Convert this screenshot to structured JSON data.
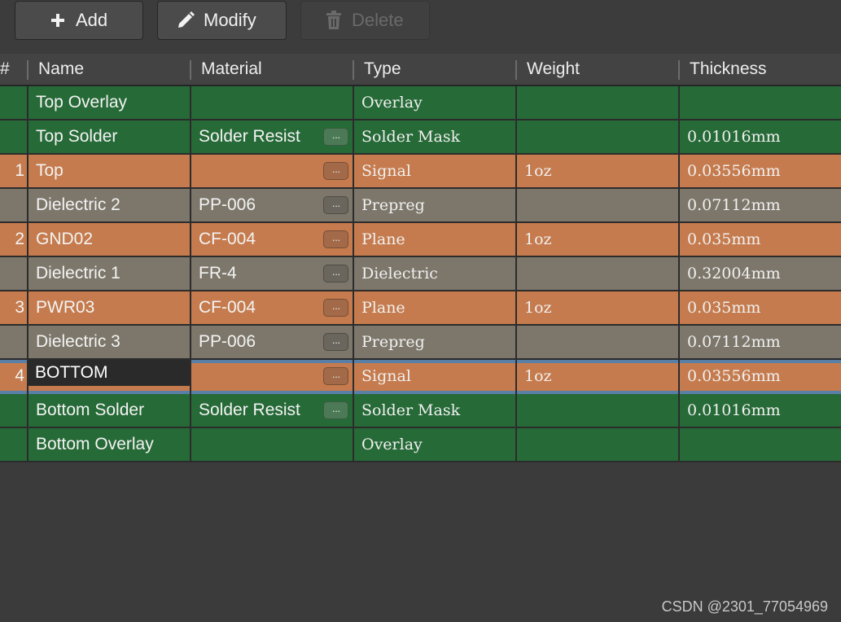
{
  "toolbar": {
    "add": {
      "label": "Add",
      "icon": "plus-icon"
    },
    "modify": {
      "label": "Modify",
      "icon": "pencil-icon"
    },
    "delete": {
      "label": "Delete",
      "icon": "trash-icon",
      "disabled": true
    }
  },
  "columns": [
    "#",
    "Name",
    "Material",
    "Type",
    "Weight",
    "Thickness"
  ],
  "colors": {
    "dielectric": "#7d776b",
    "signal": "#c57b4d",
    "mask": "#266a37",
    "selection": "#5a7fa7"
  },
  "rows": [
    {
      "num": "",
      "name": "Top Overlay",
      "material": "",
      "type": "Overlay",
      "weight": "",
      "thickness": "",
      "color": "green",
      "has_dots": false
    },
    {
      "num": "",
      "name": "Top Solder",
      "material": "Solder Resist",
      "type": "Solder Mask",
      "weight": "",
      "thickness": "0.01016mm",
      "color": "green",
      "has_dots": true
    },
    {
      "num": "1",
      "name": "Top",
      "material": "",
      "type": "Signal",
      "weight": "1oz",
      "thickness": "0.03556mm",
      "color": "orange",
      "has_dots": true
    },
    {
      "num": "",
      "name": "Dielectric 2",
      "material": "PP-006",
      "type": "Prepreg",
      "weight": "",
      "thickness": "0.07112mm",
      "color": "gray",
      "has_dots": true
    },
    {
      "num": "2",
      "name": "GND02",
      "material": "CF-004",
      "type": "Plane",
      "weight": "1oz",
      "thickness": "0.035mm",
      "color": "orange",
      "has_dots": true
    },
    {
      "num": "",
      "name": "Dielectric 1",
      "material": "FR-4",
      "type": "Dielectric",
      "weight": "",
      "thickness": "0.32004mm",
      "color": "gray",
      "has_dots": true
    },
    {
      "num": "3",
      "name": "PWR03",
      "material": "CF-004",
      "type": "Plane",
      "weight": "1oz",
      "thickness": "0.035mm",
      "color": "orange",
      "has_dots": true
    },
    {
      "num": "",
      "name": "Dielectric 3",
      "material": "PP-006",
      "type": "Prepreg",
      "weight": "",
      "thickness": "0.07112mm",
      "color": "gray",
      "has_dots": true
    },
    {
      "num": "4",
      "name": "BOTTOM",
      "material": "",
      "type": "Signal",
      "weight": "1oz",
      "thickness": "0.03556mm",
      "color": "orange",
      "has_dots": true,
      "selected": true,
      "editing": true
    },
    {
      "num": "",
      "name": "Bottom Solder",
      "material": "Solder Resist",
      "type": "Solder Mask",
      "weight": "",
      "thickness": "0.01016mm",
      "color": "green",
      "has_dots": true
    },
    {
      "num": "",
      "name": "Bottom Overlay",
      "material": "",
      "type": "Overlay",
      "weight": "",
      "thickness": "",
      "color": "green",
      "has_dots": false
    }
  ],
  "watermark": "CSDN @2301_77054969"
}
